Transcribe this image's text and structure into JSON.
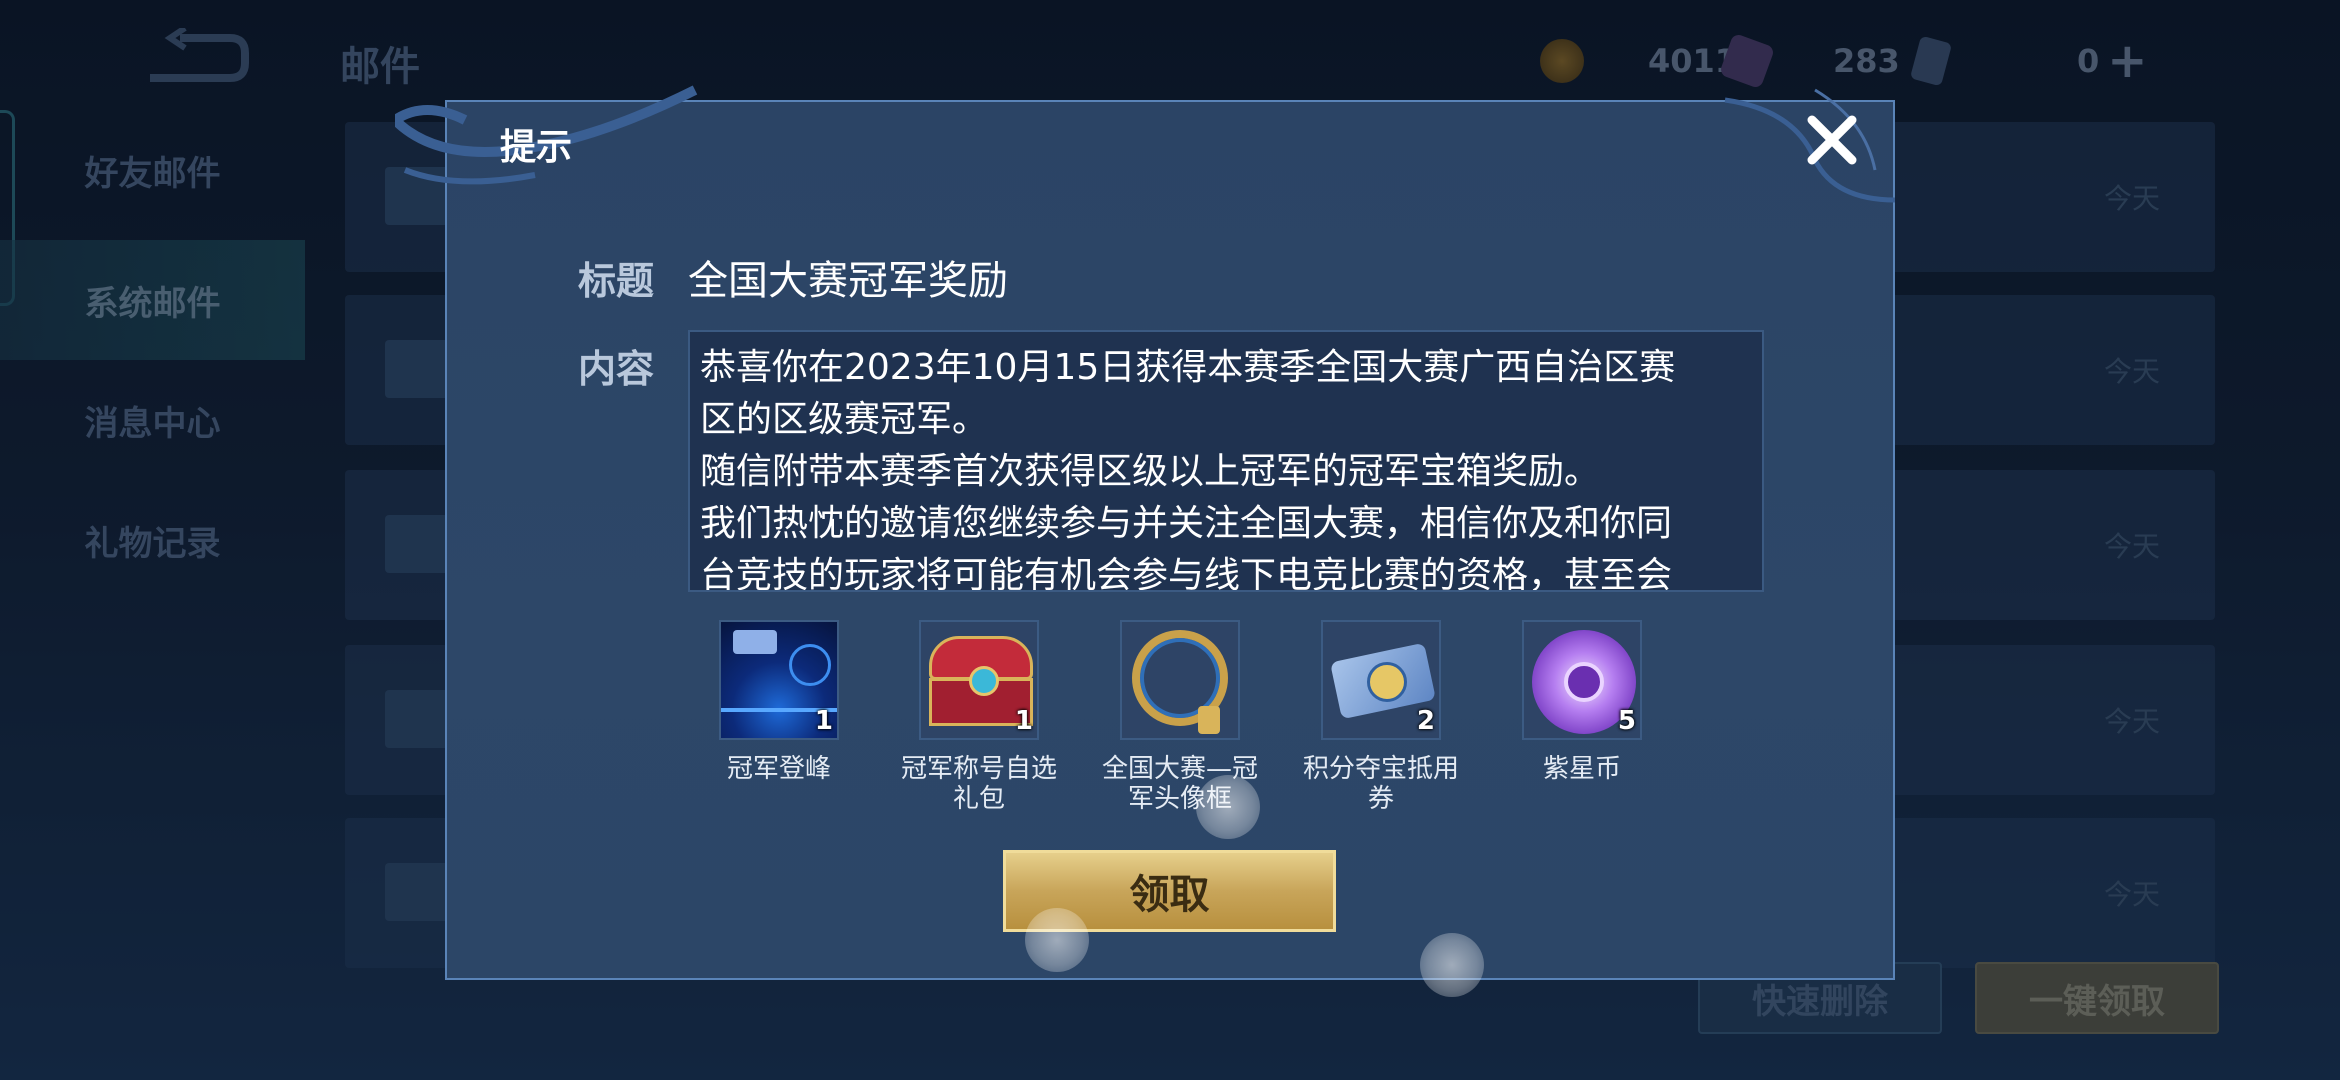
{
  "header": {
    "title": "邮件",
    "gold": "4011",
    "diamond": "283",
    "coupon": "0"
  },
  "sidebar": {
    "items": [
      {
        "label": "好友邮件"
      },
      {
        "label": "系统邮件"
      },
      {
        "label": "消息中心"
      },
      {
        "label": "礼物记录"
      }
    ]
  },
  "mail_list": {
    "rows": [
      {
        "date": "今天"
      },
      {
        "date": "今天"
      },
      {
        "date": "今天"
      },
      {
        "date": "今天"
      },
      {
        "date": "今天"
      }
    ]
  },
  "footer": {
    "delete_label": "快速删除",
    "claim_all_label": "一键领取"
  },
  "dialog": {
    "title": "提示",
    "subject_label": "标题",
    "subject": "全国大赛冠军奖励",
    "content_label": "内容",
    "content": "恭喜你在2023年10月15日获得本赛季全国大赛广西自治区赛\n区的区级赛冠军。\n随信附带本赛季首次获得区级以上冠军的冠军宝箱奖励。\n我们热忱的邀请您继续参与并关注全国大赛，相信你及和你同\n台竞技的玩家将可能有机会参与线下电竞比赛的资格，甚至会",
    "rewards": [
      {
        "name": "冠军登峰",
        "count": "1"
      },
      {
        "name": "冠军称号自选\n礼包",
        "count": "1"
      },
      {
        "name": "全国大赛—冠\n军头像框",
        "count": ""
      },
      {
        "name": "积分夺宝抵用\n券",
        "count": "2"
      },
      {
        "name": "紫星币",
        "count": "5"
      }
    ],
    "claim_label": "领取"
  },
  "colors": {
    "accent_gold": "#c8a55a",
    "dialog_bg": "#2b4465"
  }
}
